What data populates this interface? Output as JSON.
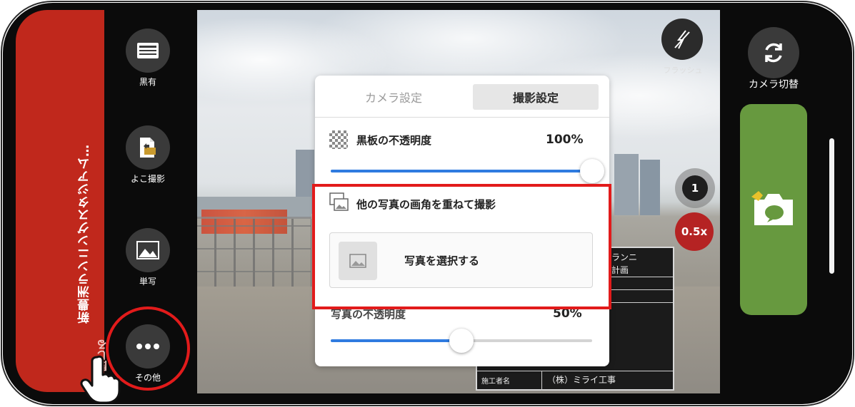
{
  "project": {
    "title": "新豊洲ランニングスタジアム…",
    "close_label": "閉じる"
  },
  "left_toolbar": {
    "items": [
      {
        "label": "黒有",
        "icon": "blackboard-icon"
      },
      {
        "label": "よこ撮影",
        "icon": "landscape-shot-icon"
      },
      {
        "label": "単写",
        "icon": "image-icon"
      },
      {
        "label": "その他",
        "icon": "more-icon"
      }
    ]
  },
  "camera": {
    "flash_label": "フラッシュ",
    "zoom_levels": [
      "1",
      "0.5x"
    ],
    "switch_label": "カメラ切替",
    "accent_color": "#67993f"
  },
  "settings_panel": {
    "tabs": [
      "カメラ設定",
      "撮影設定"
    ],
    "active_tab": "撮影設定",
    "board_opacity": {
      "label": "黒板の不透明度",
      "value": "100%",
      "level": 1.0
    },
    "overlay": {
      "label": "他の写真の画角を重ねて撮影",
      "button": "写真を選択する"
    },
    "photo_opacity": {
      "label": "写真の不透明度",
      "value": "50%",
      "level": 0.5
    }
  },
  "blackboard": {
    "project_text": "洲ランニ",
    "project_text2": "ム計画",
    "contractor_label": "施工者名",
    "contractor_value": "（株）ミライ工事"
  },
  "colors": {
    "highlight": "#e21b1b",
    "side_panel": "#c0281c",
    "slider": "#2f7be0"
  }
}
